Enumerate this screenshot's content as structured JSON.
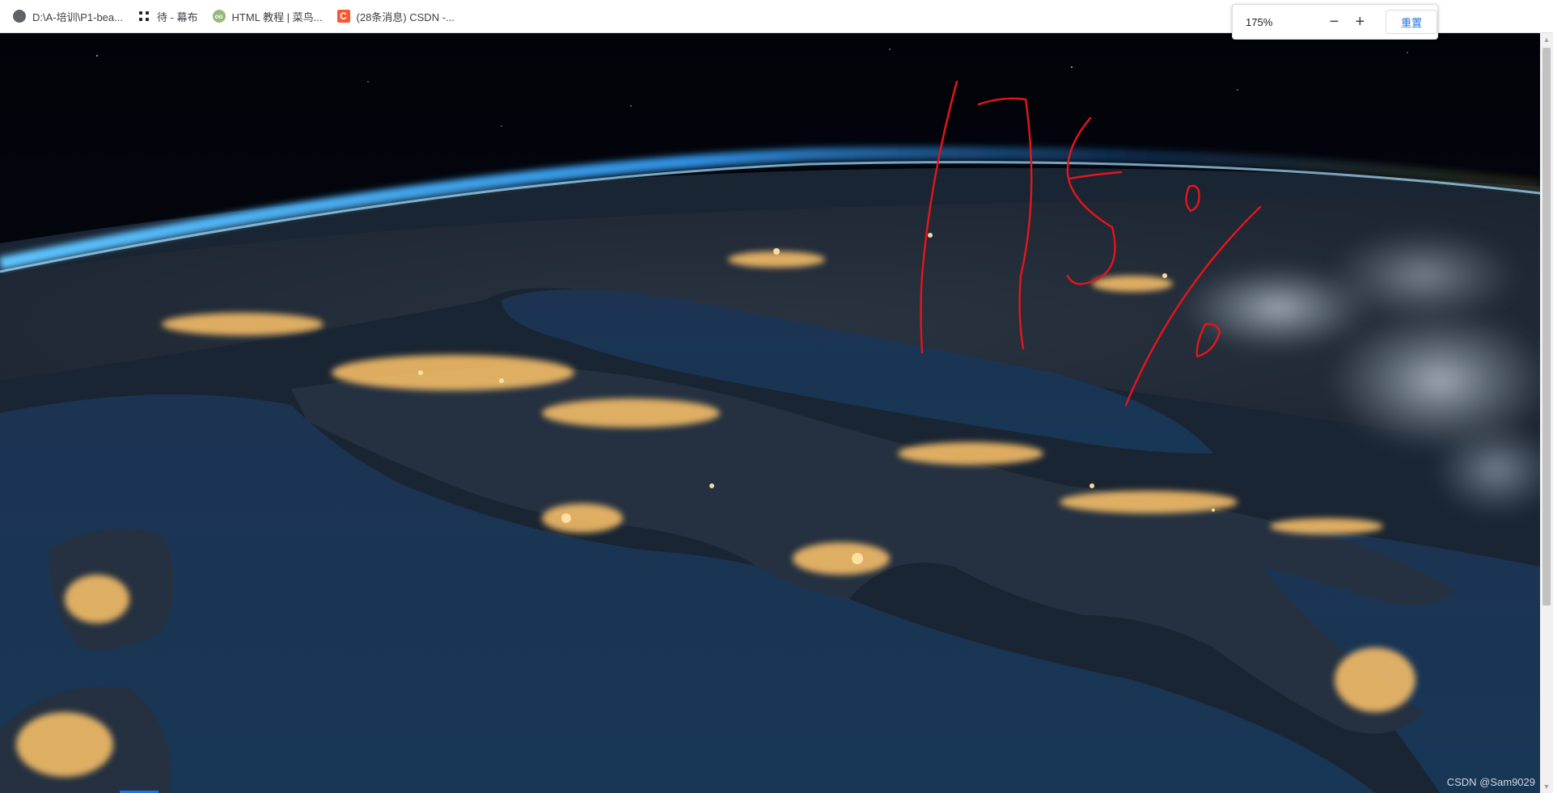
{
  "bookmarks": [
    {
      "label": "D:\\A-培训\\P1-bea...",
      "icon": "globe-icon"
    },
    {
      "label": "待 - 幕布",
      "icon": "mubu-icon"
    },
    {
      "label": "HTML 教程 | 菜鸟...",
      "icon": "runoob-icon"
    },
    {
      "label": "(28条消息) CSDN -...",
      "icon": "csdn-icon"
    }
  ],
  "zoom": {
    "level_text": "175%",
    "minus": "−",
    "plus": "+",
    "reset_label": "重置"
  },
  "handwriting": "175%",
  "watermark": "CSDN @Sam9029",
  "colors": {
    "accent": "#1a73e8",
    "ink": "#e8141c",
    "ocean": "#17324e",
    "city_lights": "#ffc46b"
  }
}
